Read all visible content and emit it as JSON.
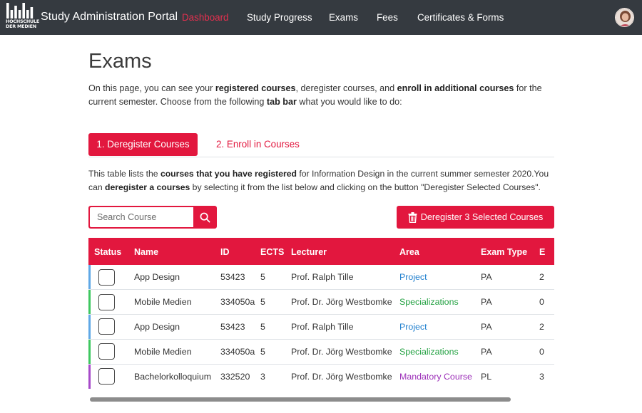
{
  "app": {
    "logo_text_line1": "HOCHSCHULE",
    "logo_text_line2": "DER MEDIEN",
    "brand": "Study Administration Portal"
  },
  "nav": {
    "items": [
      {
        "label": "Dashboard",
        "active": true
      },
      {
        "label": "Study Progress",
        "active": false
      },
      {
        "label": "Exams",
        "active": false
      },
      {
        "label": "Fees",
        "active": false
      },
      {
        "label": "Certificates & Forms",
        "active": false
      }
    ]
  },
  "page": {
    "title": "Exams",
    "intro": [
      {
        "text": "On this page, you can see your ",
        "bold": false
      },
      {
        "text": "registered courses",
        "bold": true
      },
      {
        "text": ", deregister courses, and ",
        "bold": false
      },
      {
        "text": "enroll in additional courses",
        "bold": true
      },
      {
        "text": " for the current semester. Choose from the following ",
        "bold": false
      },
      {
        "text": "tab bar",
        "bold": true
      },
      {
        "text": " what you would like to do:",
        "bold": false
      }
    ]
  },
  "tabs": {
    "deregister": "1. Deregister Courses",
    "enroll": "2. Enroll in Courses"
  },
  "description": [
    {
      "text": "This table lists the ",
      "bold": false
    },
    {
      "text": "courses that you have registered",
      "bold": true
    },
    {
      "text": " for Information Design in the current summer semester 2020.You can ",
      "bold": false
    },
    {
      "text": "deregister a courses",
      "bold": true
    },
    {
      "text": " by selecting it from the list below and clicking on the button \"Deregister Selected Courses\".",
      "bold": false
    }
  ],
  "search": {
    "placeholder": "Search Course"
  },
  "deregister_button": "Deregister 3 Selected Courses",
  "table": {
    "headers": {
      "status": "Status",
      "name": "Name",
      "id": "ID",
      "ects": "ECTS",
      "lecturer": "Lecturer",
      "area": "Area",
      "exam_type": "Exam Type",
      "extra": "E"
    },
    "rows": [
      {
        "name": "App Design",
        "id": "53423",
        "ects": "5",
        "lecturer": "Prof. Ralph Tille",
        "area": "Project",
        "area_kind": "project",
        "exam_type": "PA",
        "extra": "2"
      },
      {
        "name": "Mobile Medien",
        "id": "334050a",
        "ects": "5",
        "lecturer": "Prof. Dr. Jörg Westbomke",
        "area": "Specializations",
        "area_kind": "spec",
        "exam_type": "PA",
        "extra": "0"
      },
      {
        "name": "App Design",
        "id": "53423",
        "ects": "5",
        "lecturer": "Prof. Ralph Tille",
        "area": "Project",
        "area_kind": "project",
        "exam_type": "PA",
        "extra": "2"
      },
      {
        "name": "Mobile Medien",
        "id": "334050a",
        "ects": "5",
        "lecturer": "Prof. Dr. Jörg Westbomke",
        "area": "Specializations",
        "area_kind": "spec",
        "exam_type": "PA",
        "extra": "0"
      },
      {
        "name": "Bachelorkolloquium",
        "id": "332520",
        "ects": "3",
        "lecturer": "Prof. Dr. Jörg Westbomke",
        "area": "Mandatory Course",
        "area_kind": "mand",
        "exam_type": "PL",
        "extra": "3"
      }
    ]
  },
  "colors": {
    "accent": "#e2173e",
    "active_nav": "#e5304f",
    "navbar_bg": "#353a40",
    "area_project": "#1f7fce",
    "area_specializations": "#23a142",
    "area_mandatory": "#9c2fb8"
  },
  "icons": {
    "search": "search-icon",
    "trash": "trash-icon",
    "avatar": "user-avatar"
  }
}
